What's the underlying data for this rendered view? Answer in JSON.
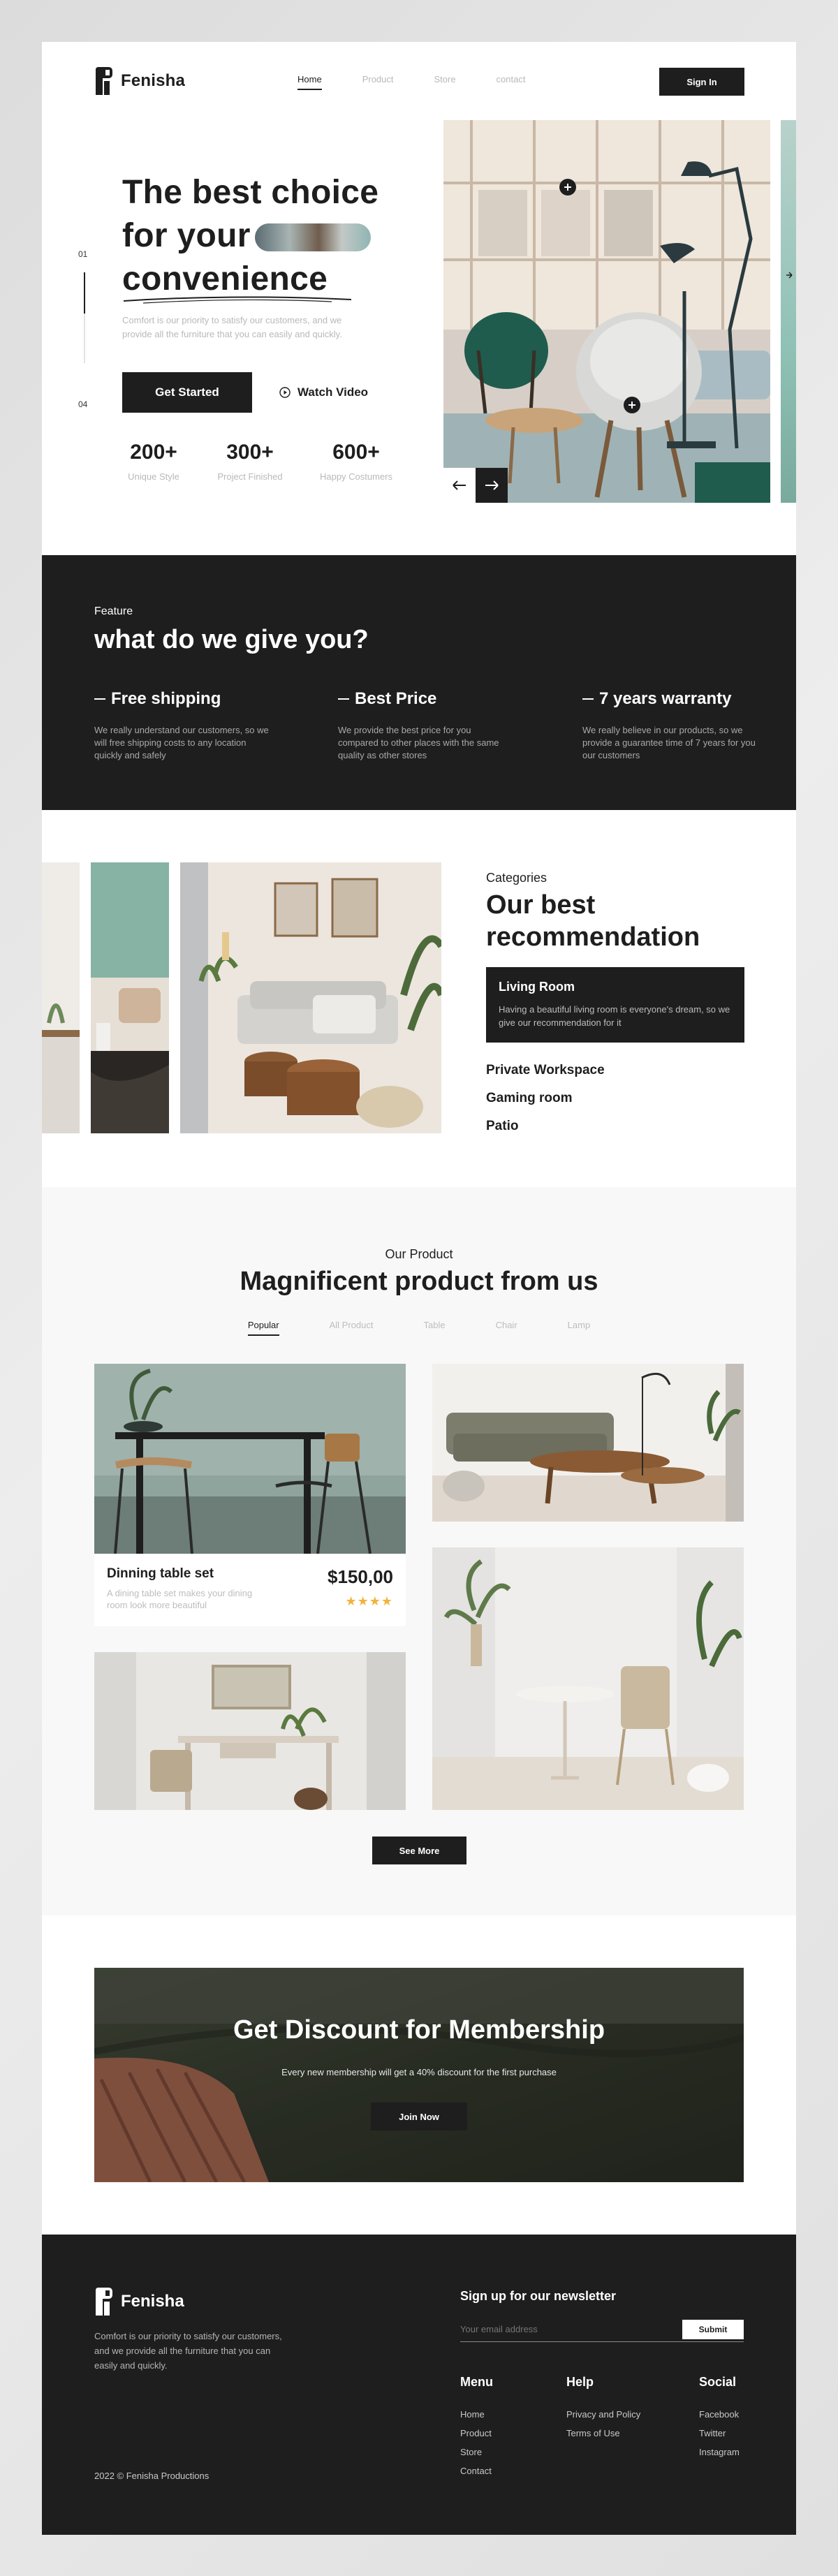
{
  "brand": {
    "name": "Fenisha"
  },
  "nav": {
    "items": [
      "Home",
      "Product",
      "Store",
      "contact"
    ],
    "active": "Home",
    "sign_in": "Sign In"
  },
  "hero": {
    "line1": "The best choice",
    "line2": "for your",
    "line3": "convenience",
    "description": "Comfort is our priority to satisfy our customers, and we provide all the furniture that you can easily and quickly.",
    "primary_button": "Get Started",
    "secondary_button": "Watch Video",
    "counter_start": "01",
    "counter_end": "04",
    "stats": [
      {
        "number": "200+",
        "label": "Unique Style"
      },
      {
        "number": "300+",
        "label": "Project Finished"
      },
      {
        "number": "600+",
        "label": "Happy Costumers"
      }
    ],
    "carousel_progress": 0.45
  },
  "feature": {
    "tag": "Feature",
    "title": "what do we give you?",
    "items": [
      {
        "title": "Free shipping",
        "text": "We really understand our customers, so we will free shipping costs to any location quickly and safely"
      },
      {
        "title": "Best Price",
        "text": "We provide the best price for you compared to other places with the same quality as other stores"
      },
      {
        "title": "7 years warranty",
        "text": "We really believe in our products, so we provide a guarantee time of 7 years for you our customers"
      }
    ]
  },
  "categories": {
    "tag": "Categories",
    "title": "Our best recommendation",
    "active": {
      "title": "Living Room",
      "text": "Having a beautiful living room is everyone's dream, so we give our recommendation for it"
    },
    "items": [
      "Private Workspace",
      "Gaming room",
      "Patio"
    ]
  },
  "products": {
    "tag": "Our Product",
    "title": "Magnificent product from us",
    "tabs": [
      "Popular",
      "All Product",
      "Table",
      "Chair",
      "Lamp"
    ],
    "active_tab": "Popular",
    "featured": {
      "title": "Dinning table set",
      "text": "A dining table set makes your dining room look more beautiful",
      "price": "$150,00",
      "stars": "★★★★",
      "rating": 4
    },
    "see_more": "See More"
  },
  "discount": {
    "title": "Get Discount for Membership",
    "text": "Every new membership will get a 40% discount for the first purchase",
    "button": "Join Now"
  },
  "footer": {
    "description": "Comfort is our priority to satisfy our customers, and we provide all the furniture that you can easily and quickly.",
    "copyright": "2022 © Fenisha Productions",
    "newsletter_title": "Sign up for our newsletter",
    "email_placeholder": "Your email address",
    "submit": "Submit",
    "columns": [
      {
        "title": "Menu",
        "links": [
          "Home",
          "Product",
          "Store",
          "Contact"
        ]
      },
      {
        "title": "Help",
        "links": [
          "Privacy and Policy",
          "Terms of Use"
        ]
      },
      {
        "title": "Social",
        "links": [
          "Facebook",
          "Twitter",
          "Instagram"
        ]
      }
    ]
  },
  "colors": {
    "dark": "#1e1e1e",
    "accent_green": "#8fc1b5",
    "star": "#f2b33d",
    "muted": "#b9b9b9"
  }
}
